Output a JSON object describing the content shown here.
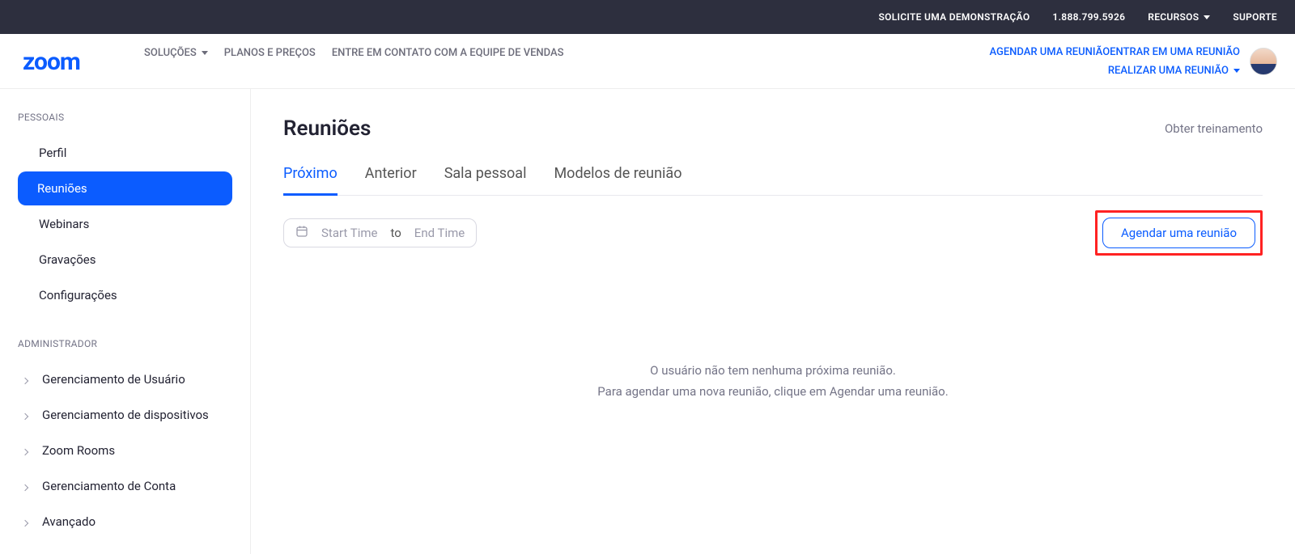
{
  "topbar": {
    "demo": "SOLICITE UMA DEMONSTRAÇÃO",
    "phone": "1.888.799.5926",
    "resources": "RECURSOS",
    "support": "SUPORTE"
  },
  "secondbar": {
    "logo_text": "zoom",
    "solutions": "SOLUÇÕES",
    "plans": "PLANOS E PREÇOS",
    "contact_sales": "ENTRE EM CONTATO COM A EQUIPE DE VENDAS",
    "schedule": "AGENDAR UMA REUNIÃO",
    "join": "ENTRAR EM UMA REUNIÃO",
    "host": "REALIZAR UMA REUNIÃO"
  },
  "sidebar": {
    "personal_header": "PESSOAIS",
    "items_personal": [
      {
        "label": "Perfil"
      },
      {
        "label": "Reuniões"
      },
      {
        "label": "Webinars"
      },
      {
        "label": "Gravações"
      },
      {
        "label": "Configurações"
      }
    ],
    "admin_header": "ADMINISTRADOR",
    "items_admin": [
      {
        "label": "Gerenciamento de Usuário"
      },
      {
        "label": "Gerenciamento de dispositivos"
      },
      {
        "label": "Zoom Rooms"
      },
      {
        "label": "Gerenciamento de Conta"
      },
      {
        "label": "Avançado"
      }
    ]
  },
  "main": {
    "title": "Reuniões",
    "training": "Obter treinamento",
    "tabs": [
      {
        "label": "Próximo"
      },
      {
        "label": "Anterior"
      },
      {
        "label": "Sala pessoal"
      },
      {
        "label": "Modelos de reunião"
      }
    ],
    "daterange": {
      "start": "Start Time",
      "to": "to",
      "end": "End Time"
    },
    "schedule_btn": "Agendar uma reunião",
    "empty_line1": "O usuário não tem nenhuma próxima reunião.",
    "empty_line2": "Para agendar uma nova reunião, clique em Agendar uma reunião."
  }
}
